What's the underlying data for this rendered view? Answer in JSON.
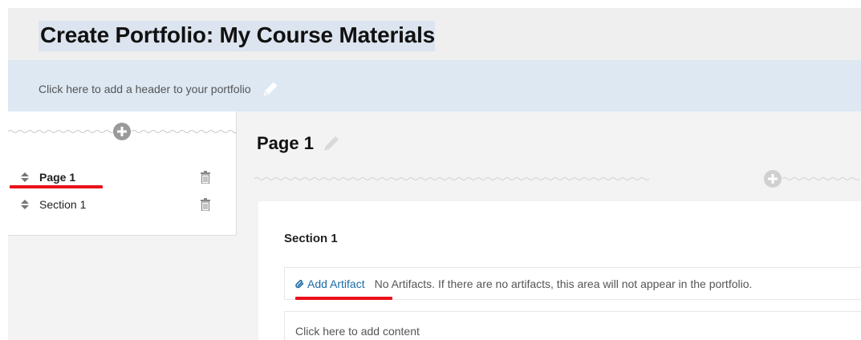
{
  "portfolio": {
    "title": "Create Portfolio: My Course Materials",
    "header_hint": "Click here to add a header to your portfolio"
  },
  "sidebar": {
    "items": [
      {
        "label": "Page 1",
        "icon": "sort-icon",
        "action_icon": "trash-icon",
        "highlighted": true
      },
      {
        "label": "Section 1",
        "icon": "sort-icon",
        "action_icon": "trash-icon",
        "highlighted": false
      }
    ],
    "add_icon": "plus-circle-icon"
  },
  "main": {
    "page_title": "Page 1",
    "edit_icon": "pencil-icon",
    "add_icon": "plus-circle-icon",
    "section": {
      "title": "Section 1",
      "add_artifact_label": "Add Artifact",
      "artifact_icon": "paperclip-icon",
      "no_artifacts_text": "No Artifacts. If there are no artifacts, this area will not appear in the portfolio.",
      "content_placeholder": "Click here to add content"
    }
  },
  "colors": {
    "title_bg": "#efefef",
    "header_bg": "#dde8f3",
    "link": "#1a6aa6",
    "annotation_red": "#e8101a",
    "panel_bg": "#f3f3f3"
  }
}
